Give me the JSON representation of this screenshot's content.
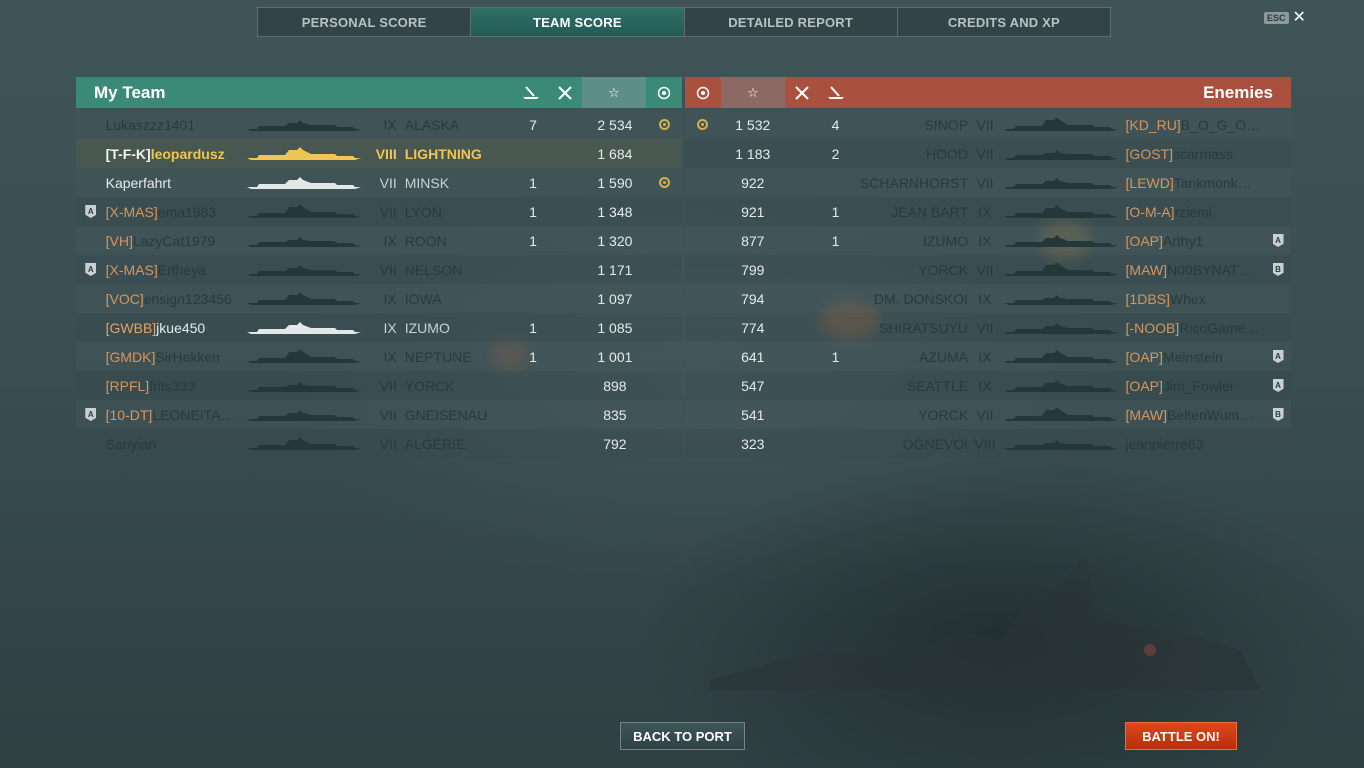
{
  "tabs": [
    {
      "label": "PERSONAL SCORE",
      "active": false
    },
    {
      "label": "TEAM SCORE",
      "active": true
    },
    {
      "label": "DETAILED REPORT",
      "active": false
    },
    {
      "label": "CREDITS AND XP",
      "active": false
    }
  ],
  "esc": {
    "key": "ESC",
    "close": "✕"
  },
  "my_team": {
    "title": "My Team",
    "columns": {
      "kills_icon": "ship-kill-icon",
      "planes_icon": "plane-kill-icon",
      "score_icon": "☆",
      "award_icon": "award-icon"
    },
    "players": [
      {
        "division": "",
        "clan": "",
        "name": "Lukaszzz1401",
        "tier": "IX",
        "ship": "ALASKA",
        "kills": "7",
        "planes": "",
        "score": "2 534",
        "award": true,
        "state": "dead"
      },
      {
        "division": "",
        "clan": "[T-F-K]",
        "name": "leopardusz",
        "tier": "VIII",
        "ship": "LIGHTNING",
        "kills": "",
        "planes": "",
        "score": "1 684",
        "award": false,
        "state": "self"
      },
      {
        "division": "",
        "clan": "",
        "name": "Kaperfahrt",
        "tier": "VII",
        "ship": "MINSK",
        "kills": "1",
        "planes": "",
        "score": "1 590",
        "award": true,
        "state": "alive"
      },
      {
        "division": "A",
        "clan": "[X-MAS]",
        "name": "ema1983",
        "tier": "VII",
        "ship": "LYON",
        "kills": "1",
        "planes": "",
        "score": "1 348",
        "award": false,
        "state": "dead"
      },
      {
        "division": "",
        "clan": "[VH]",
        "name": "LazyCat1979",
        "tier": "IX",
        "ship": "ROON",
        "kills": "1",
        "planes": "",
        "score": "1 320",
        "award": false,
        "state": "dead"
      },
      {
        "division": "A",
        "clan": "[X-MAS]",
        "name": "Ertheya",
        "tier": "VII",
        "ship": "NELSON",
        "kills": "",
        "planes": "",
        "score": "1 171",
        "award": false,
        "state": "dead"
      },
      {
        "division": "",
        "clan": "[VOC]",
        "name": "ensign123456",
        "tier": "IX",
        "ship": "IOWA",
        "kills": "",
        "planes": "",
        "score": "1 097",
        "award": false,
        "state": "dead"
      },
      {
        "division": "",
        "clan": "[GWBB]",
        "name": "jkue450",
        "tier": "IX",
        "ship": "IZUMO",
        "kills": "1",
        "planes": "",
        "score": "1 085",
        "award": false,
        "state": "alive"
      },
      {
        "division": "",
        "clan": "[GMDK]",
        "name": "SirHekken",
        "tier": "IX",
        "ship": "NEPTUNE",
        "kills": "1",
        "planes": "",
        "score": "1 001",
        "award": false,
        "state": "dead"
      },
      {
        "division": "",
        "clan": "[RPFL]",
        "name": "frits333",
        "tier": "VII",
        "ship": "YORCK",
        "kills": "",
        "planes": "",
        "score": "898",
        "award": false,
        "state": "dead"
      },
      {
        "division": "A",
        "clan": "[10-DT]",
        "name": "LEONEITA…",
        "tier": "VII",
        "ship": "GNEISENAU",
        "kills": "",
        "planes": "",
        "score": "835",
        "award": false,
        "state": "dead"
      },
      {
        "division": "",
        "clan": "",
        "name": "Sanyian",
        "tier": "VII",
        "ship": "ALGÈRIE",
        "kills": "",
        "planes": "",
        "score": "792",
        "award": false,
        "state": "dead"
      }
    ]
  },
  "enemies": {
    "title": "Enemies",
    "players": [
      {
        "award": true,
        "score": "1 532",
        "planes": "",
        "kills": "4",
        "ship": "SINOP",
        "tier": "VII",
        "clan": "[KD_RU]",
        "name": "B_O_G_O…",
        "division": "",
        "state": "dead"
      },
      {
        "award": false,
        "score": "1 183",
        "planes": "",
        "kills": "2",
        "ship": "HOOD",
        "tier": "VII",
        "clan": "[GOST]",
        "name": "scarmass",
        "division": "",
        "state": "dead"
      },
      {
        "award": false,
        "score": "922",
        "planes": "",
        "kills": "",
        "ship": "SCHARNHORST",
        "tier": "VII",
        "clan": "[LEWD]",
        "name": "Tankmonk…",
        "division": "",
        "state": "dead"
      },
      {
        "award": false,
        "score": "921",
        "planes": "",
        "kills": "1",
        "ship": "JEAN BART",
        "tier": "IX",
        "clan": "[O-M-A]",
        "name": "rziemi",
        "division": "",
        "state": "dead"
      },
      {
        "award": false,
        "score": "877",
        "planes": "",
        "kills": "1",
        "ship": "IZUMO",
        "tier": "IX",
        "clan": "[OAP]",
        "name": "Arthy1",
        "division": "A",
        "state": "dead"
      },
      {
        "award": false,
        "score": "799",
        "planes": "",
        "kills": "",
        "ship": "YORCK",
        "tier": "VII",
        "clan": "[MAW]",
        "name": "N00BYNAT…",
        "division": "B",
        "state": "dead"
      },
      {
        "award": false,
        "score": "794",
        "planes": "",
        "kills": "",
        "ship": "DM. DONSKOI",
        "tier": "IX",
        "clan": "[1DBS]",
        "name": "Whex",
        "division": "",
        "state": "dead"
      },
      {
        "award": false,
        "score": "774",
        "planes": "",
        "kills": "",
        "ship": "SHIRATSUYU",
        "tier": "VII",
        "clan": "[-NOOB]",
        "name": "RicoGame…",
        "division": "",
        "state": "dead"
      },
      {
        "award": false,
        "score": "641",
        "planes": "",
        "kills": "1",
        "ship": "AZUMA",
        "tier": "IX",
        "clan": "[OAP]",
        "name": "Meinstein",
        "division": "A",
        "state": "dead"
      },
      {
        "award": false,
        "score": "547",
        "planes": "",
        "kills": "",
        "ship": "SEATTLE",
        "tier": "IX",
        "clan": "[OAP]",
        "name": "Jim_Fowler",
        "division": "A",
        "state": "dead"
      },
      {
        "award": false,
        "score": "541",
        "planes": "",
        "kills": "",
        "ship": "YORCK",
        "tier": "VII",
        "clan": "[MAW]",
        "name": "BeltenWum…",
        "division": "B",
        "state": "dead"
      },
      {
        "award": false,
        "score": "323",
        "planes": "",
        "kills": "",
        "ship": "OGNEVOI",
        "tier": "VIII",
        "clan": "",
        "name": "jeanpierre63",
        "division": "",
        "state": "dead"
      }
    ]
  },
  "buttons": {
    "back": "BACK TO PORT",
    "battle": "BATTLE ON!"
  },
  "colors": {
    "my_team": "#3b8a78",
    "enemies": "#a9503f",
    "clan": "#e2a36a",
    "self": "#f0c552",
    "battle": "#d03c14"
  }
}
